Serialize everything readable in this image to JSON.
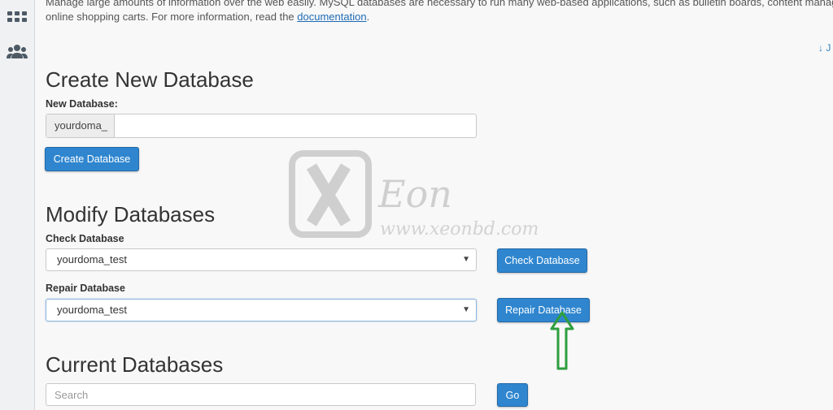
{
  "sidebar": {
    "icons": [
      "apps-grid-icon",
      "users-icon"
    ]
  },
  "intro": {
    "line1": "Manage large amounts of information over the web easily. MySQL databases are necessary to run many web-based applications, such as bulletin boards, content management",
    "line2_prefix": "online shopping carts. For more information, read the ",
    "link": "documentation",
    "line2_suffix": "."
  },
  "jump_link": "↓ J",
  "create": {
    "title": "Create New Database",
    "field_label": "New Database:",
    "prefix": "yourdoma_",
    "value": "",
    "button": "Create Database"
  },
  "modify": {
    "title": "Modify Databases",
    "check_label": "Check Database",
    "check_selected": "yourdoma_test",
    "check_button": "Check Database",
    "repair_label": "Repair Database",
    "repair_selected": "yourdoma_test",
    "repair_button": "Repair Database"
  },
  "current": {
    "title": "Current Databases",
    "search_placeholder": "Search",
    "go_button": "Go"
  },
  "watermark": {
    "letter": "X",
    "brand": "Eon",
    "url": "www.xeonbd.com"
  },
  "colors": {
    "accent": "#2f86cf",
    "arrow": "#2e9e3e",
    "watermark": "#c9c9c9"
  }
}
